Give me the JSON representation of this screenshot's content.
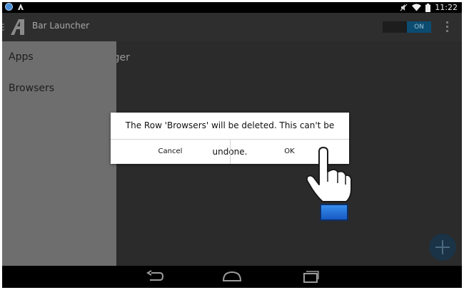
{
  "status_bar": {
    "time": "11:22",
    "icons": [
      "notification-icon",
      "bar-launcher-icon",
      "no-sound-icon",
      "wifi-icon",
      "battery-icon"
    ]
  },
  "action_bar": {
    "title": "Bar Launcher",
    "toggle_label": "ON",
    "icons": [
      "drawer-menu-icon",
      "app-logo-icon",
      "overflow-menu-icon"
    ]
  },
  "drawer": {
    "items": [
      {
        "label": "Apps"
      },
      {
        "label": "Browsers"
      }
    ]
  },
  "content": {
    "peek_text": "ager"
  },
  "dialog": {
    "message": "The Row 'Browsers' will be deleted. This can't be undone.",
    "cancel_label": "Cancel",
    "ok_label": "OK"
  },
  "nav_bar": {
    "icons": [
      "back-icon",
      "home-icon",
      "recents-icon"
    ]
  },
  "colors": {
    "drawer_bg": "#6e6e6e",
    "actionbar_bg": "#2e2e2e",
    "toggle_on": "#0c4c70",
    "cuff_blue": "#1a6ed8"
  }
}
